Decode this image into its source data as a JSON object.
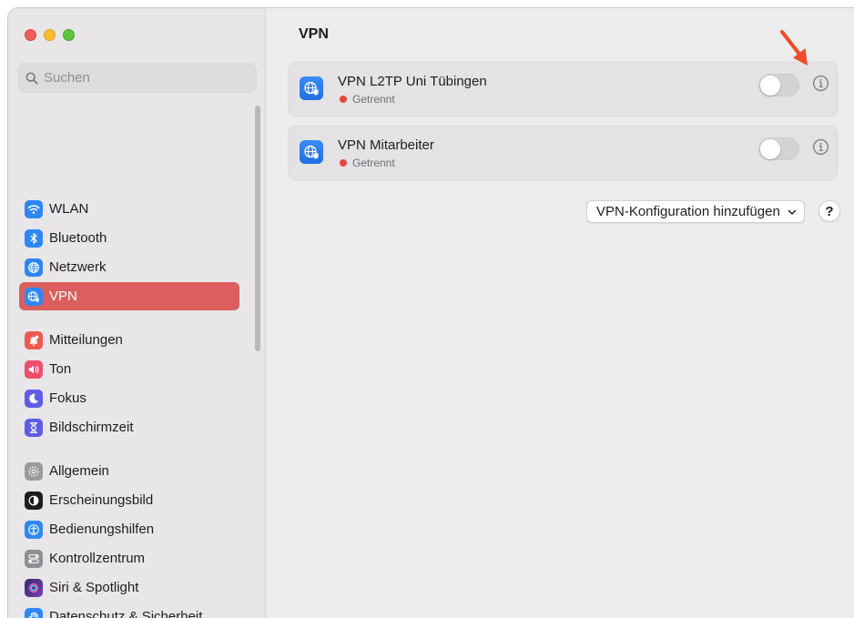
{
  "window": {
    "traffic_lights": {
      "close": "#ee5d57",
      "minimize": "#f5bd2f",
      "zoom": "#5fc43f"
    }
  },
  "sidebar": {
    "search": {
      "placeholder": "Suchen",
      "icon": "magnifier-icon"
    },
    "items": [
      {
        "label": "WLAN",
        "icon": "wifi-icon",
        "icon_bg": "#2f87f6"
      },
      {
        "label": "Bluetooth",
        "icon": "bluetooth-icon",
        "icon_bg": "#2f87f6"
      },
      {
        "label": "Netzwerk",
        "icon": "globe-icon",
        "icon_bg": "#2f87f6"
      },
      {
        "label": "VPN",
        "icon": "vpn-globe-icon",
        "icon_bg": "#2f87f6",
        "selected": true
      },
      {
        "label": "Mitteilungen",
        "icon": "bell-icon",
        "icon_bg": "#ee5a4f"
      },
      {
        "label": "Ton",
        "icon": "speaker-icon",
        "icon_bg": "#ee4e6a"
      },
      {
        "label": "Fokus",
        "icon": "moon-icon",
        "icon_bg": "#5e5ce6"
      },
      {
        "label": "Bildschirmzeit",
        "icon": "hourglass-icon",
        "icon_bg": "#5e5ce6"
      },
      {
        "label": "Allgemein",
        "icon": "gear-icon",
        "icon_bg": "#9a9a9e"
      },
      {
        "label": "Erscheinungsbild",
        "icon": "appearance-icon",
        "icon_bg": "#1d1d1f"
      },
      {
        "label": "Bedienungshilfen",
        "icon": "accessibility-icon",
        "icon_bg": "#2f87f6"
      },
      {
        "label": "Kontrollzentrum",
        "icon": "control-center-icon",
        "icon_bg": "#8e8e93"
      },
      {
        "label": "Siri & Spotlight",
        "icon": "siri-icon",
        "icon_bg": "#3a3a6e"
      },
      {
        "label": "Datenschutz & Sicherheit",
        "icon": "hand-icon",
        "icon_bg": "#2f87f6"
      }
    ],
    "selected_color": "#db5f5e"
  },
  "main": {
    "title": "VPN",
    "vpns": [
      {
        "name": "VPN L2TP Uni Tübingen",
        "status": "Getrennt",
        "enabled": false
      },
      {
        "name": "VPN Mitarbeiter",
        "status": "Getrennt",
        "enabled": false
      }
    ],
    "status_color": "#e8453c",
    "add_button": "VPN-Konfiguration hinzufügen",
    "help": "?"
  },
  "annotation": {
    "arrow_color": "#ee4b2b",
    "points_to": "info-button"
  }
}
